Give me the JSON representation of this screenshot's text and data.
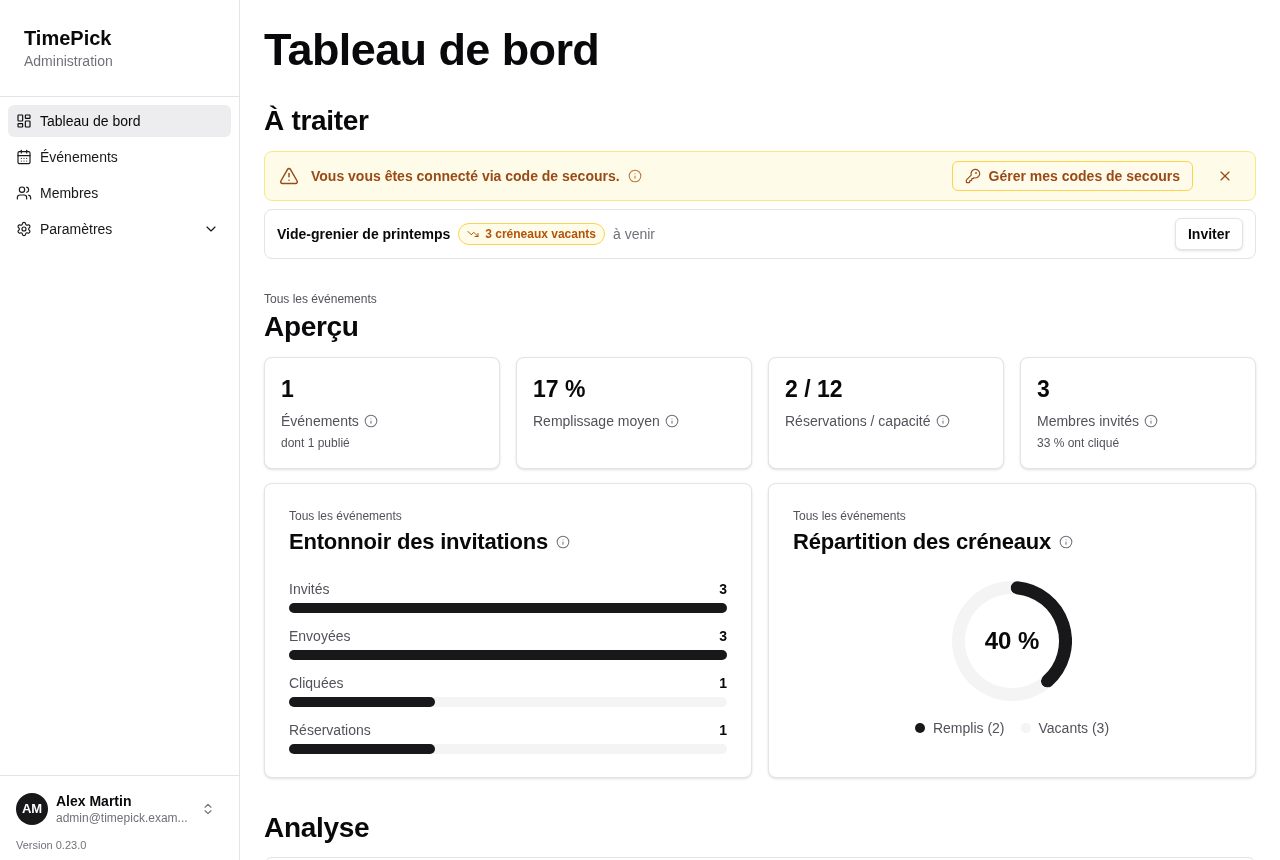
{
  "sidebar": {
    "brand": "TimePick",
    "subtitle": "Administration",
    "nav": [
      {
        "label": "Tableau de bord",
        "selected": true
      },
      {
        "label": "Événements",
        "selected": false
      },
      {
        "label": "Membres",
        "selected": false
      },
      {
        "label": "Paramètres",
        "selected": false,
        "expanded": false
      }
    ],
    "user": {
      "initials": "AM",
      "name": "Alex Martin",
      "email": "admin@timepick.exam..."
    },
    "version": "Version 0.23.0"
  },
  "page_title": "Tableau de bord",
  "todo": {
    "heading": "À traiter",
    "alert": {
      "message": "Vous vous êtes connecté via code de secours.",
      "action": "Gérer mes codes de secours"
    },
    "events": [
      {
        "name": "Vide-grenier de printemps",
        "badge": "3 créneaux vacants",
        "status": "à venir",
        "action": "Inviter"
      }
    ]
  },
  "overview": {
    "scope": "Tous les événements",
    "heading": "Aperçu",
    "stats": [
      {
        "value": "1",
        "label": "Événements",
        "note": "dont 1 publié"
      },
      {
        "value": "17 %",
        "label": "Remplissage moyen"
      },
      {
        "value": "2 / 12",
        "label": "Réservations / capacité"
      },
      {
        "value": "3",
        "label": "Membres invités",
        "note": "33 % ont cliqué"
      }
    ]
  },
  "funnel": {
    "scope": "Tous les événements",
    "title": "Entonnoir des invitations",
    "rows": [
      {
        "label": "Invités",
        "value": "3",
        "level": 1
      },
      {
        "label": "Envoyées",
        "value": "3",
        "level": 1
      },
      {
        "label": "Cliquées",
        "value": "1",
        "level": 0.333
      },
      {
        "label": "Réservations",
        "value": "1",
        "level": 0.333
      }
    ]
  },
  "slots": {
    "scope": "Tous les événements",
    "title": "Répartition des créneaux",
    "center_label": "40 %",
    "chart_data": {
      "type": "donut",
      "categories": [
        "Remplis (2)",
        "Vacants (3)"
      ],
      "values": [
        2,
        3
      ],
      "legend": "bottom"
    },
    "slices": [
      {
        "color": "#18181b"
      },
      {
        "color": "#f4f4f5"
      }
    ]
  },
  "analysis": {
    "heading": "Analyse"
  }
}
